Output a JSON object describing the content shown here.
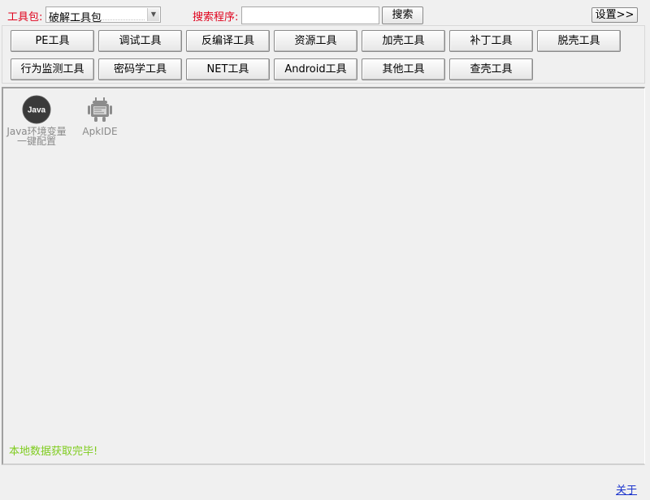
{
  "toolbar": {
    "package_label": "工具包:",
    "package_selected": "破解工具包",
    "search_label": "搜索程序:",
    "search_value": "",
    "search_button": "搜索",
    "settings_button": "设置>>"
  },
  "categories": [
    "PE工具",
    "调试工具",
    "反编译工具",
    "资源工具",
    "加壳工具",
    "补丁工具",
    "脱壳工具",
    "行为监测工具",
    "密码学工具",
    "NET工具",
    "Android工具",
    "其他工具",
    "查壳工具"
  ],
  "tools": [
    {
      "name": "Java环境变量一键配置",
      "icon": "java-icon",
      "icon_text": "Java"
    },
    {
      "name": "ApkIDE",
      "icon": "apkide-icon"
    }
  ],
  "status": "本地数据获取完毕!",
  "footer": {
    "about_link": "关于"
  },
  "colors": {
    "label_red": "#e0001b",
    "status_green": "#7fcc1e",
    "link_blue": "#1a33cc",
    "window_bg": "#f0f0f0"
  }
}
